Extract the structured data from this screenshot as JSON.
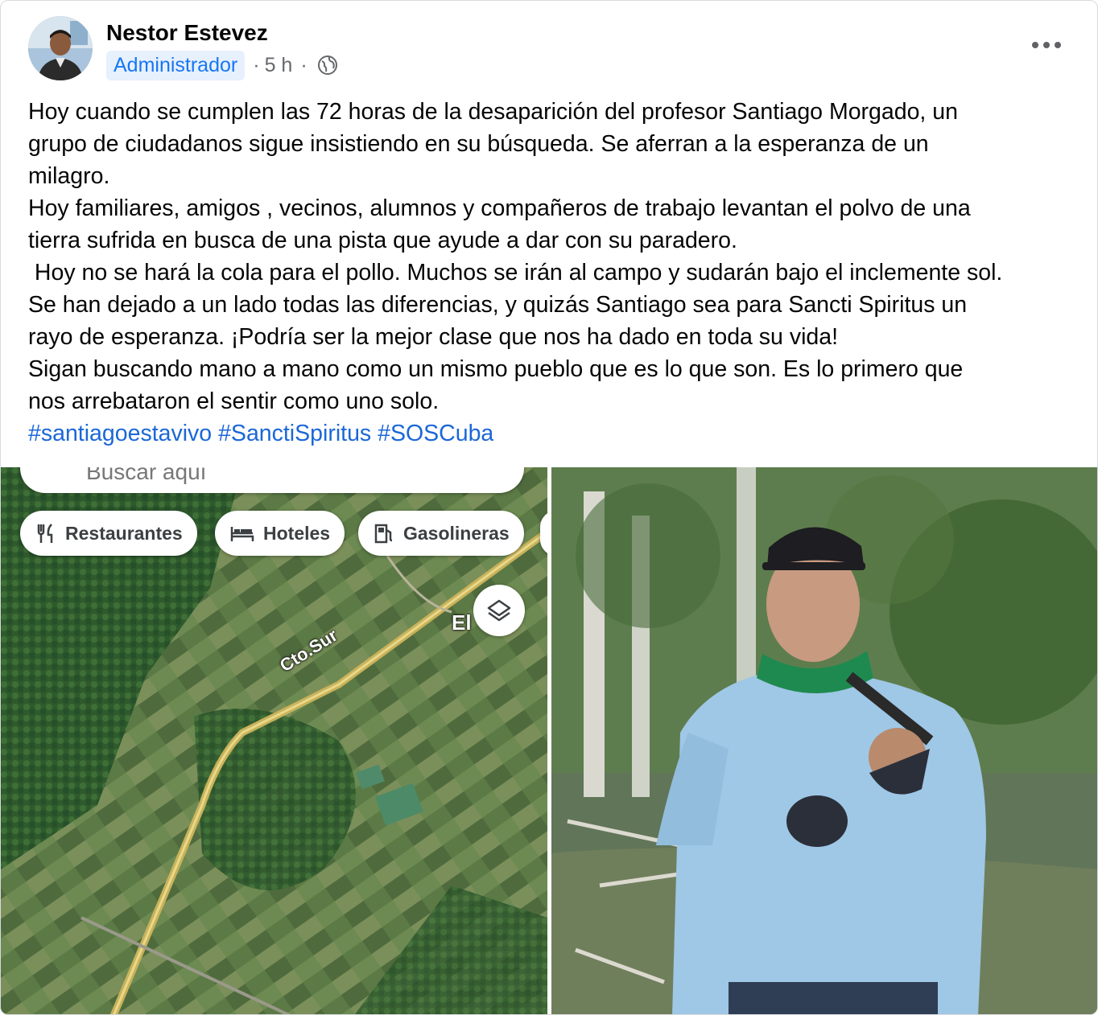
{
  "post": {
    "author": "Nestor Estevez",
    "role": "Administrador",
    "time": "5 h",
    "separator": "·",
    "visibility_icon": "globe-icon",
    "more_icon": "more-horizontal-icon",
    "paragraphs": [
      "Hoy cuando se cumplen las 72 horas de la desaparición del profesor Santiago Morgado, un",
      "grupo de ciudadanos sigue insistiendo en su búsqueda. Se aferran a la esperanza de un",
      "milagro.",
      "Hoy familiares, amigos , vecinos, alumnos y compañeros de trabajo levantan el polvo de una",
      "tierra sufrida en busca de una pista que ayude a dar con su paradero.",
      " Hoy no se hará la cola para el pollo. Muchos se irán al campo y sudarán bajo el inclemente sol.",
      "Se han dejado a un lado todas las diferencias, y quizás Santiago sea para Sancti Spiritus un",
      "rayo de esperanza. ¡Podría ser la mejor clase que nos ha dado en toda su vida!",
      "Sigan buscando mano a mano como un mismo pueblo que es lo que son. Es lo primero que",
      "nos arrebataron el sentir como uno solo."
    ],
    "hashtags": [
      "#santiagoestavivo",
      "#SanctiSpiritus",
      "#SOSCuba"
    ]
  },
  "map_screenshot": {
    "search_placeholder": "Buscar aquí",
    "chips": [
      {
        "label": "Restaurantes",
        "icon": "fork-knife-icon"
      },
      {
        "label": "Hoteles",
        "icon": "bed-icon"
      },
      {
        "label": "Gasolineras",
        "icon": "gas-pump-icon"
      }
    ],
    "road_label": "Cto.Sur",
    "place_label": "El",
    "layers_icon": "layers-icon"
  },
  "colors": {
    "hashtag": "#1b67d8",
    "badge_bg": "#e7f0fd",
    "badge_text": "#1877f2",
    "meta_text": "#65676b"
  }
}
